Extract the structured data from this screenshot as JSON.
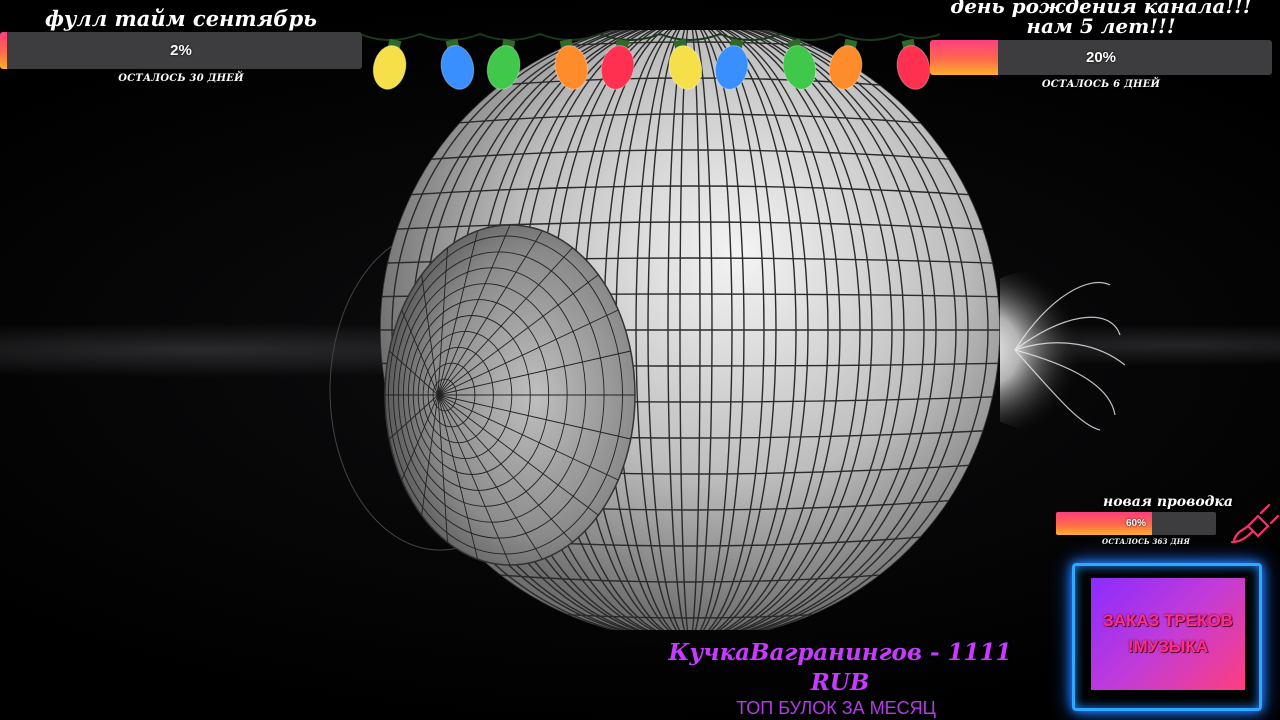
{
  "goals": [
    {
      "title": "фулл тайм сентябрь",
      "percent_label": "2%",
      "progress": 0.02,
      "remaining": "ОСТАЛОСЬ 30 ДНЕЙ"
    },
    {
      "title": "день рождения канала!!!нам 5 лет!!!",
      "percent_label": "20%",
      "progress": 0.2,
      "remaining": "ОСТАЛОСЬ 6 ДНЕЙ"
    },
    {
      "title": "новая проводка",
      "percent_label": "60%",
      "progress": 0.6,
      "remaining": "ОСТАЛОСЬ 363 ДНЯ",
      "icon": "plug-icon"
    }
  ],
  "track_order": {
    "line1": "ЗАКАЗ ТРЕКОВ",
    "line2": "!МУЗЫКА"
  },
  "top_donor": {
    "text": "КучкаВагранингов - 1111 RUB",
    "caption": "ТОП БУЛОК ЗА МЕСЯЦ"
  },
  "colors": {
    "bar_gradient": [
      "#ff3e7f",
      "#ff6a4a",
      "#ffb12b"
    ],
    "neon_border": "#2fa8ff",
    "donor_text": "#c63bff",
    "light_bulbs": [
      "#f5e04a",
      "#3a8fff",
      "#3fc84a",
      "#ff8c2a",
      "#ff3050"
    ]
  }
}
